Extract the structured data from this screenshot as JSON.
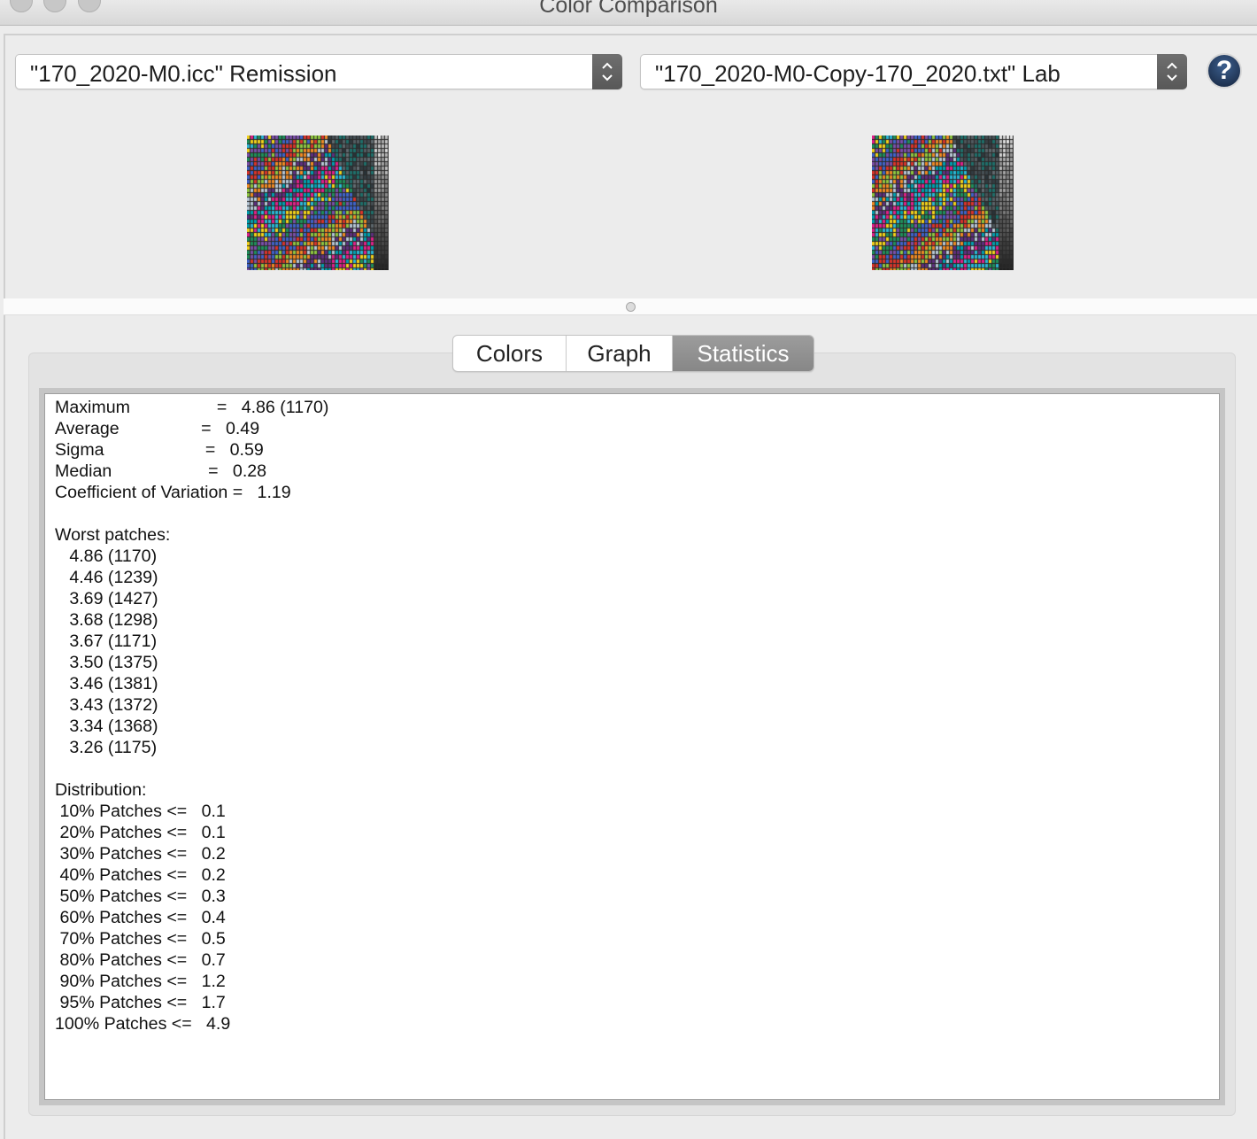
{
  "window": {
    "title": "Color Comparison"
  },
  "selectors": {
    "left_value": "\"170_2020-M0.icc\" Remission",
    "right_value": "\"170_2020-M0-Copy-170_2020.txt\" Lab",
    "help_glyph": "?"
  },
  "tabs": [
    {
      "label": "Colors",
      "active": false
    },
    {
      "label": "Graph",
      "active": false
    },
    {
      "label": "Statistics",
      "active": true
    }
  ],
  "statistics": {
    "summary": [
      {
        "label": "Maximum",
        "value": "4.86 (1170)"
      },
      {
        "label": "Average",
        "value": "0.49"
      },
      {
        "label": "Sigma",
        "value": "0.59"
      },
      {
        "label": "Median",
        "value": "0.28"
      },
      {
        "label": "Coefficient of Variation",
        "value": "1.19"
      }
    ],
    "worst_title": "Worst patches:",
    "worst_patches": [
      "4.86 (1170)",
      "4.46 (1239)",
      "3.69 (1427)",
      "3.68 (1298)",
      "3.67 (1171)",
      "3.50 (1375)",
      "3.46 (1381)",
      "3.43 (1372)",
      "3.34 (1368)",
      "3.26 (1175)"
    ],
    "distribution_title": "Distribution:",
    "distribution": [
      {
        "percent": "10%",
        "value": "0.1"
      },
      {
        "percent": "20%",
        "value": "0.1"
      },
      {
        "percent": "30%",
        "value": "0.2"
      },
      {
        "percent": "40%",
        "value": "0.2"
      },
      {
        "percent": "50%",
        "value": "0.3"
      },
      {
        "percent": "60%",
        "value": "0.4"
      },
      {
        "percent": "70%",
        "value": "0.5"
      },
      {
        "percent": "80%",
        "value": "0.7"
      },
      {
        "percent": "90%",
        "value": "1.2"
      },
      {
        "percent": "95%",
        "value": "1.7"
      },
      {
        "percent": "100%",
        "value": "4.9"
      }
    ]
  },
  "colors": {
    "tab_active_bg": "#8f8f8f",
    "help_button": "#1f3352"
  }
}
